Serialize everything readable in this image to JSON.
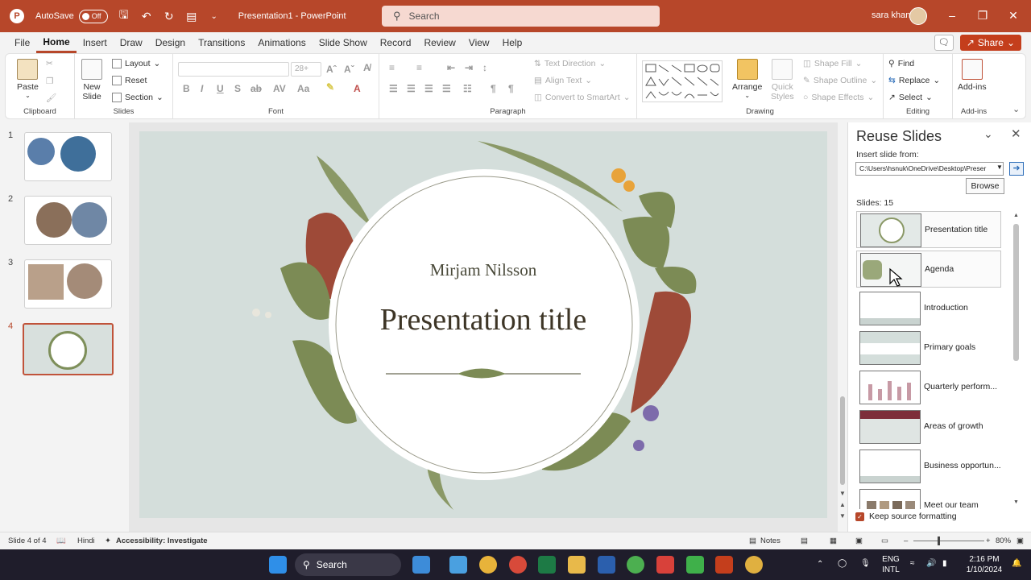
{
  "titlebar": {
    "autosave_label": "AutoSave",
    "autosave_state": "Off",
    "doc_title": "Presentation1  -  PowerPoint",
    "search_placeholder": "Search",
    "user_name": "sara khan"
  },
  "menu": {
    "tabs": [
      "File",
      "Home",
      "Insert",
      "Draw",
      "Design",
      "Transitions",
      "Animations",
      "Slide Show",
      "Record",
      "Review",
      "View",
      "Help"
    ],
    "active_tab": "Home",
    "share_label": "Share"
  },
  "ribbon": {
    "clipboard": {
      "paste": "Paste",
      "group": "Clipboard"
    },
    "slides": {
      "new_slide": "New",
      "new_slide2": "Slide",
      "layout": "Layout",
      "reset": "Reset",
      "section": "Section",
      "group": "Slides"
    },
    "font": {
      "size": "28+",
      "group": "Font"
    },
    "paragraph": {
      "text_direction": "Text Direction",
      "align_text": "Align Text",
      "smartart": "Convert to SmartArt",
      "group": "Paragraph"
    },
    "drawing": {
      "arrange": "Arrange",
      "quick_styles": "Quick",
      "quick_styles2": "Styles",
      "shape_fill": "Shape Fill",
      "shape_outline": "Shape Outline",
      "shape_effects": "Shape Effects",
      "group": "Drawing"
    },
    "editing": {
      "find": "Find",
      "replace": "Replace",
      "select": "Select",
      "group": "Editing"
    },
    "addins": {
      "label": "Add-ins",
      "group": "Add-ins"
    }
  },
  "thumbnails": {
    "numbers": [
      "1",
      "2",
      "3",
      "4"
    ],
    "selected": 4
  },
  "slide": {
    "presenter": "Mirjam Nilsson",
    "title": "Presentation title"
  },
  "reuse_panel": {
    "title": "Reuse Slides",
    "insert_from_label": "Insert slide from:",
    "path": "C:\\Users\\hsnuk\\OneDrive\\Desktop\\Preser",
    "browse": "Browse",
    "slides_count": "Slides: 15",
    "items": [
      "Presentation title",
      "Agenda",
      "Introduction",
      "Primary goals",
      "Quarterly perform...",
      "Areas of growth",
      "Business opportun...",
      "Meet our team"
    ],
    "keep_formatting": "Keep source formatting"
  },
  "statusbar": {
    "slide_info": "Slide 4 of 4",
    "language": "Hindi",
    "accessibility": "Accessibility: Investigate",
    "notes": "Notes",
    "zoom": "80%"
  },
  "taskbar": {
    "search": "Search",
    "lang1": "ENG",
    "lang2": "INTL",
    "time": "2:16 PM",
    "date": "1/10/2024"
  },
  "colors": {
    "brand": "#b7472a",
    "slide_bg": "#d4dedb"
  }
}
